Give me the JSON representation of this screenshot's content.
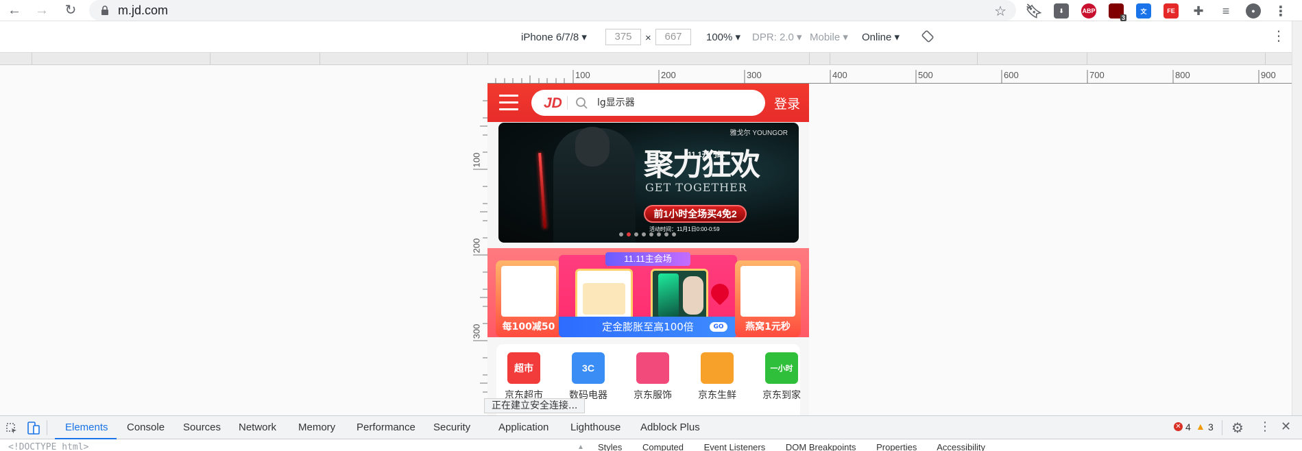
{
  "browser": {
    "url": "m.jd.com",
    "badge_count": "3"
  },
  "device_toolbar": {
    "device": "iPhone 6/7/8",
    "width": "375",
    "height": "667",
    "times": "×",
    "zoom": "100%",
    "dpr": "DPR: 2.0",
    "mode": "Mobile",
    "network": "Online"
  },
  "ruler": {
    "h_ticks": [
      "100",
      "200",
      "300",
      "400",
      "500",
      "600",
      "700",
      "800",
      "900"
    ],
    "v_ticks": [
      "100",
      "200",
      "300"
    ]
  },
  "jd": {
    "logo": "JD",
    "search_placeholder": "lg显示器",
    "login": "登录",
    "banner": {
      "title": "聚力狂欢",
      "subtitle": "11.1开门红",
      "english": "GET TOGETHER",
      "brand": "雅戈尔 YOUNGOR",
      "offer": "前1小时全场买4免2",
      "time": "活动时间：11月1日0:00-0:59",
      "dot_count": 8,
      "active_dot": 1
    },
    "promo": {
      "main_tag": "11.11主会场",
      "left_caption": "每100减50",
      "right_caption": "燕窝1元秒",
      "bar_text": "定金膨胀至高100倍",
      "go": "GO"
    },
    "categories": [
      {
        "label": "京东超市",
        "icon_text": "超市",
        "color": "#f23c3c"
      },
      {
        "label": "数码电器",
        "icon_text": "3C",
        "color": "#3a8df5"
      },
      {
        "label": "京东服饰",
        "icon_text": "",
        "color": "#f24a7a"
      },
      {
        "label": "京东生鲜",
        "icon_text": "",
        "color": "#f7a12b"
      },
      {
        "label": "京东到家",
        "icon_text": "一小时",
        "color": "#2fbf3a"
      }
    ]
  },
  "status": "正在建立安全连接...",
  "devtools": {
    "tabs": [
      "Elements",
      "Console",
      "Sources",
      "Network",
      "Memory",
      "Performance",
      "Security",
      "Application",
      "Lighthouse",
      "Adblock Plus"
    ],
    "active_tab": "Elements",
    "errors": "4",
    "warnings": "3",
    "code_line": "<!DOCTYPE html>",
    "side_tabs": [
      "Styles",
      "Computed",
      "Event Listeners",
      "DOM Breakpoints",
      "Properties",
      "Accessibility"
    ]
  }
}
